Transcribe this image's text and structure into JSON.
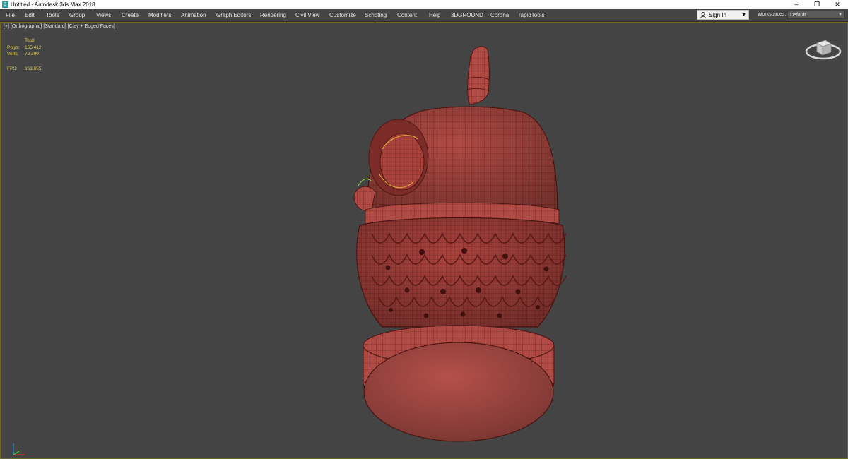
{
  "window": {
    "title": "Untitled - Autodesk 3ds Max 2018",
    "icon": "3ds-max-app-icon",
    "controls": [
      "–",
      "❐",
      "✕"
    ]
  },
  "menu": {
    "items": [
      "File",
      "Edit",
      "Tools",
      "Group",
      "Views",
      "Create",
      "Modifiers",
      "Animation",
      "Graph Editors",
      "Rendering",
      "Civil View",
      "Customize",
      "Scripting",
      "Content",
      "Help",
      "3DGROUND",
      "Corona",
      "rapidTools"
    ]
  },
  "signin": {
    "label": "Sign In",
    "icon": "person-icon"
  },
  "workspaces": {
    "label": "Workspaces:",
    "value": "Default"
  },
  "viewport": {
    "label_parts": [
      "[+]",
      "[Orthographic]",
      "[Standard]",
      "[Clay + Edged Faces]"
    ],
    "stats": {
      "header": "Total",
      "polys_label": "Polys:",
      "polys_value": "155 412",
      "verts_label": "Verts:",
      "verts_value": "79 309",
      "fps_label": "FPS:",
      "fps_value": "363,055"
    },
    "colors": {
      "model": "#b04a44",
      "wire": "#5a1a17",
      "frame": "#6e6c1b",
      "background": "#444444"
    }
  }
}
